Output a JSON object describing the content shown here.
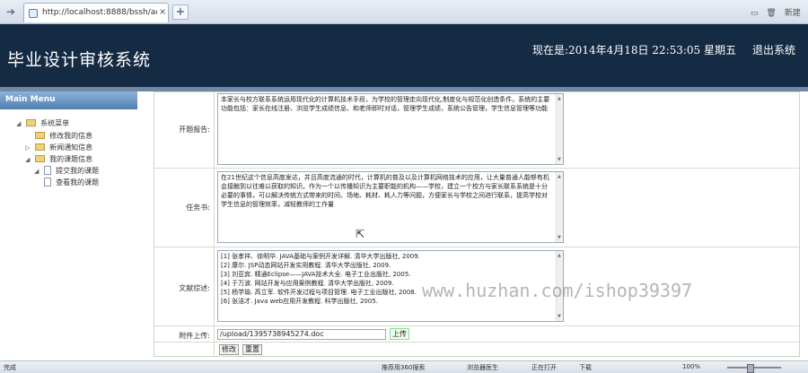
{
  "browser": {
    "tab_url": "http://localhost:8888/bssh/admi...",
    "close": "×",
    "new_tab": "+",
    "win_controls": [
      "▭",
      "🗑",
      "新建"
    ]
  },
  "header": {
    "title": "毕业设计审核系统",
    "datetime": "现在是:2014年4月18日 22:53:05 星期五",
    "logout": "退出系统"
  },
  "sidebar": {
    "menu_title": "Main Menu",
    "items": [
      {
        "label": "系统菜单",
        "toggle": "◢"
      },
      {
        "label": "修改我的信息",
        "toggle": ""
      },
      {
        "label": "新闻通知信息",
        "toggle": "▷"
      },
      {
        "label": "我的课题信息",
        "toggle": "◢"
      },
      {
        "label": "提交我的课题",
        "toggle": "◢"
      },
      {
        "label": "查看我的课题",
        "toggle": ""
      }
    ]
  },
  "form": {
    "fields": {
      "opening_report": {
        "label": "开题报告:",
        "value": "本家长与校方联系系统运用现代化的计算机技术手段，为学校的管理走向现代化,制度化与规范化创造条件。系统的主要功能包括：家长在线注册、浏览学生成绩信息、和老师即时对话，管理学生成绩，系统公告管理，学生信息管理等功能"
      },
      "task_book": {
        "label": "任务书:",
        "value": "在21世纪这个信息高度发达，并且高度流通的时代，计算机的普及以及计算机网络技术的应用，让大量普通人能够有机会接触到以往难以获取的知识。作为一个以传播知识为主要职能的机构——学校，建立一个校方与家长联系系统是十分必要的事情，可以解决传统方式带来的时间、场地、耗材、耗人力等问题，方便家长与学校之间进行联系，提高学校对学生信息的管理效率，减轻教师的工作量"
      },
      "references": {
        "label": "文献综述:",
        "lines": [
          "[1] 张孝祥、徐明华. JAVA基础与案例开发详解. 清华大学出版社, 2009.",
          "[2] 康尔. JSP动态网站开发实用教程. 清华大学出版社, 2009.",
          "[3] 刘亚宾. 精通Eclipse——JAVA技术大全. 电子工业出版社, 2005.",
          "[4] 于万波. 网站开发与应用案例教程. 清华大学出版社, 2009.",
          "[5] 杨学瑜. 高立军. 软件开发过程与项目管理. 电子工业出版社, 2008.",
          "[6] 张洁才. Java web应用开发教程. 科学出版社, 2005."
        ]
      },
      "attachment": {
        "label": "附件上传:",
        "value": "/upload/1395738945274.doc",
        "upload_label": "上传"
      }
    },
    "buttons": {
      "modify": "修改",
      "reset": "重置"
    }
  },
  "watermark": "www.huzhan.com/ishop39397",
  "statusbar": {
    "left": "完成",
    "items": [
      "推荐用360搜索",
      "浏览器医生",
      "正在打开",
      "下载",
      "100%"
    ]
  }
}
